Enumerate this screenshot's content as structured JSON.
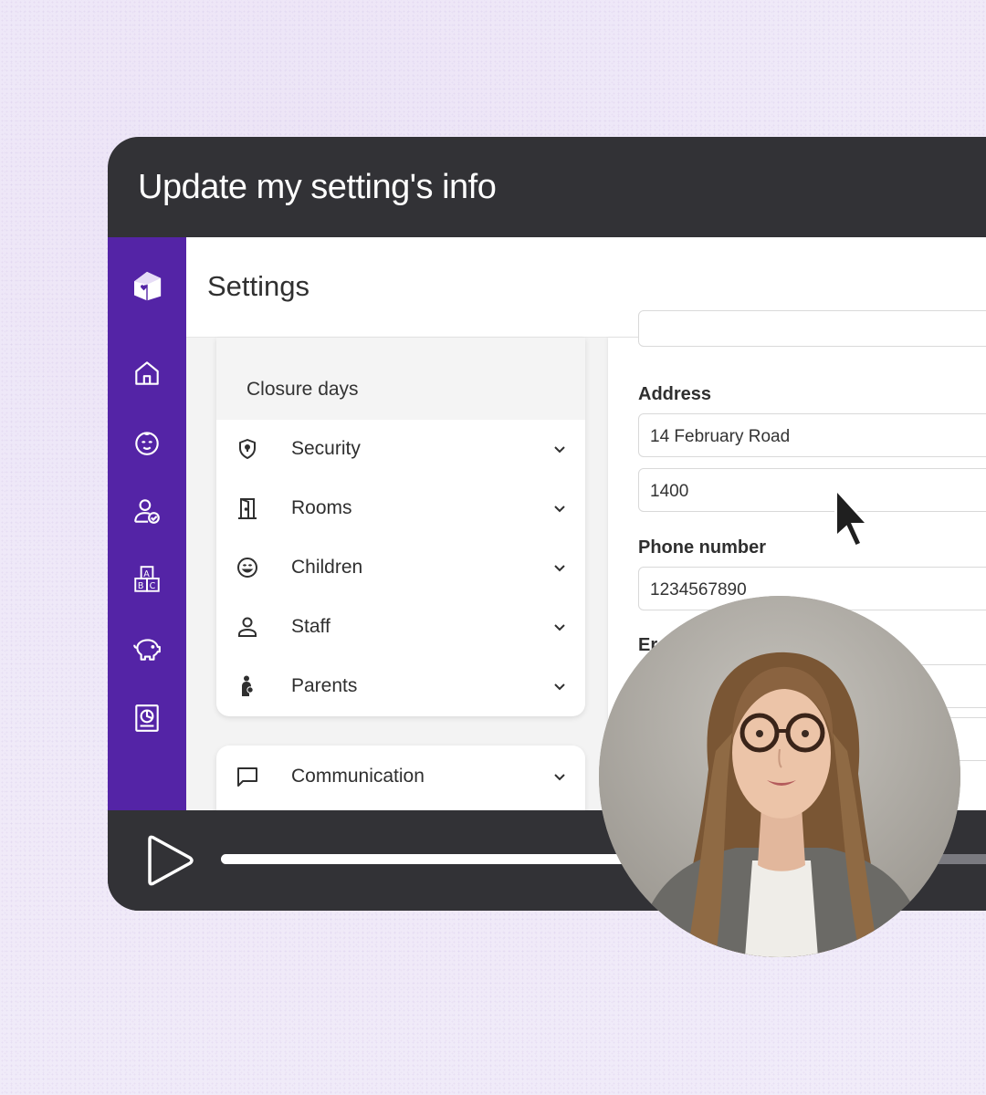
{
  "card": {
    "title": "Update my setting's info"
  },
  "app": {
    "header_title": "Settings",
    "rail_icons": [
      "nursery-logo-icon",
      "home-icon",
      "baby-face-icon",
      "staff-check-icon",
      "abc-blocks-icon",
      "piggy-bank-icon",
      "reports-icon"
    ]
  },
  "nav": {
    "partial_item": "Closure days",
    "items": [
      {
        "label": "Security",
        "icon": "shield-icon"
      },
      {
        "label": "Rooms",
        "icon": "door-icon"
      },
      {
        "label": "Children",
        "icon": "smiley-icon"
      },
      {
        "label": "Staff",
        "icon": "person-icon"
      },
      {
        "label": "Parents",
        "icon": "parent-child-icon"
      }
    ],
    "communication": {
      "label": "Communication",
      "icon": "chat-icon"
    }
  },
  "form": {
    "address_label": "Address",
    "address_line1": "14 February Road",
    "address_line2": "1400",
    "phone_label": "Phone number",
    "phone_value": "1234567890",
    "email_label_partial": "Er"
  },
  "player": {
    "progress": 0.62
  },
  "colors": {
    "rail": "#5424a6",
    "card": "#323236",
    "background": "#efe9f8"
  }
}
